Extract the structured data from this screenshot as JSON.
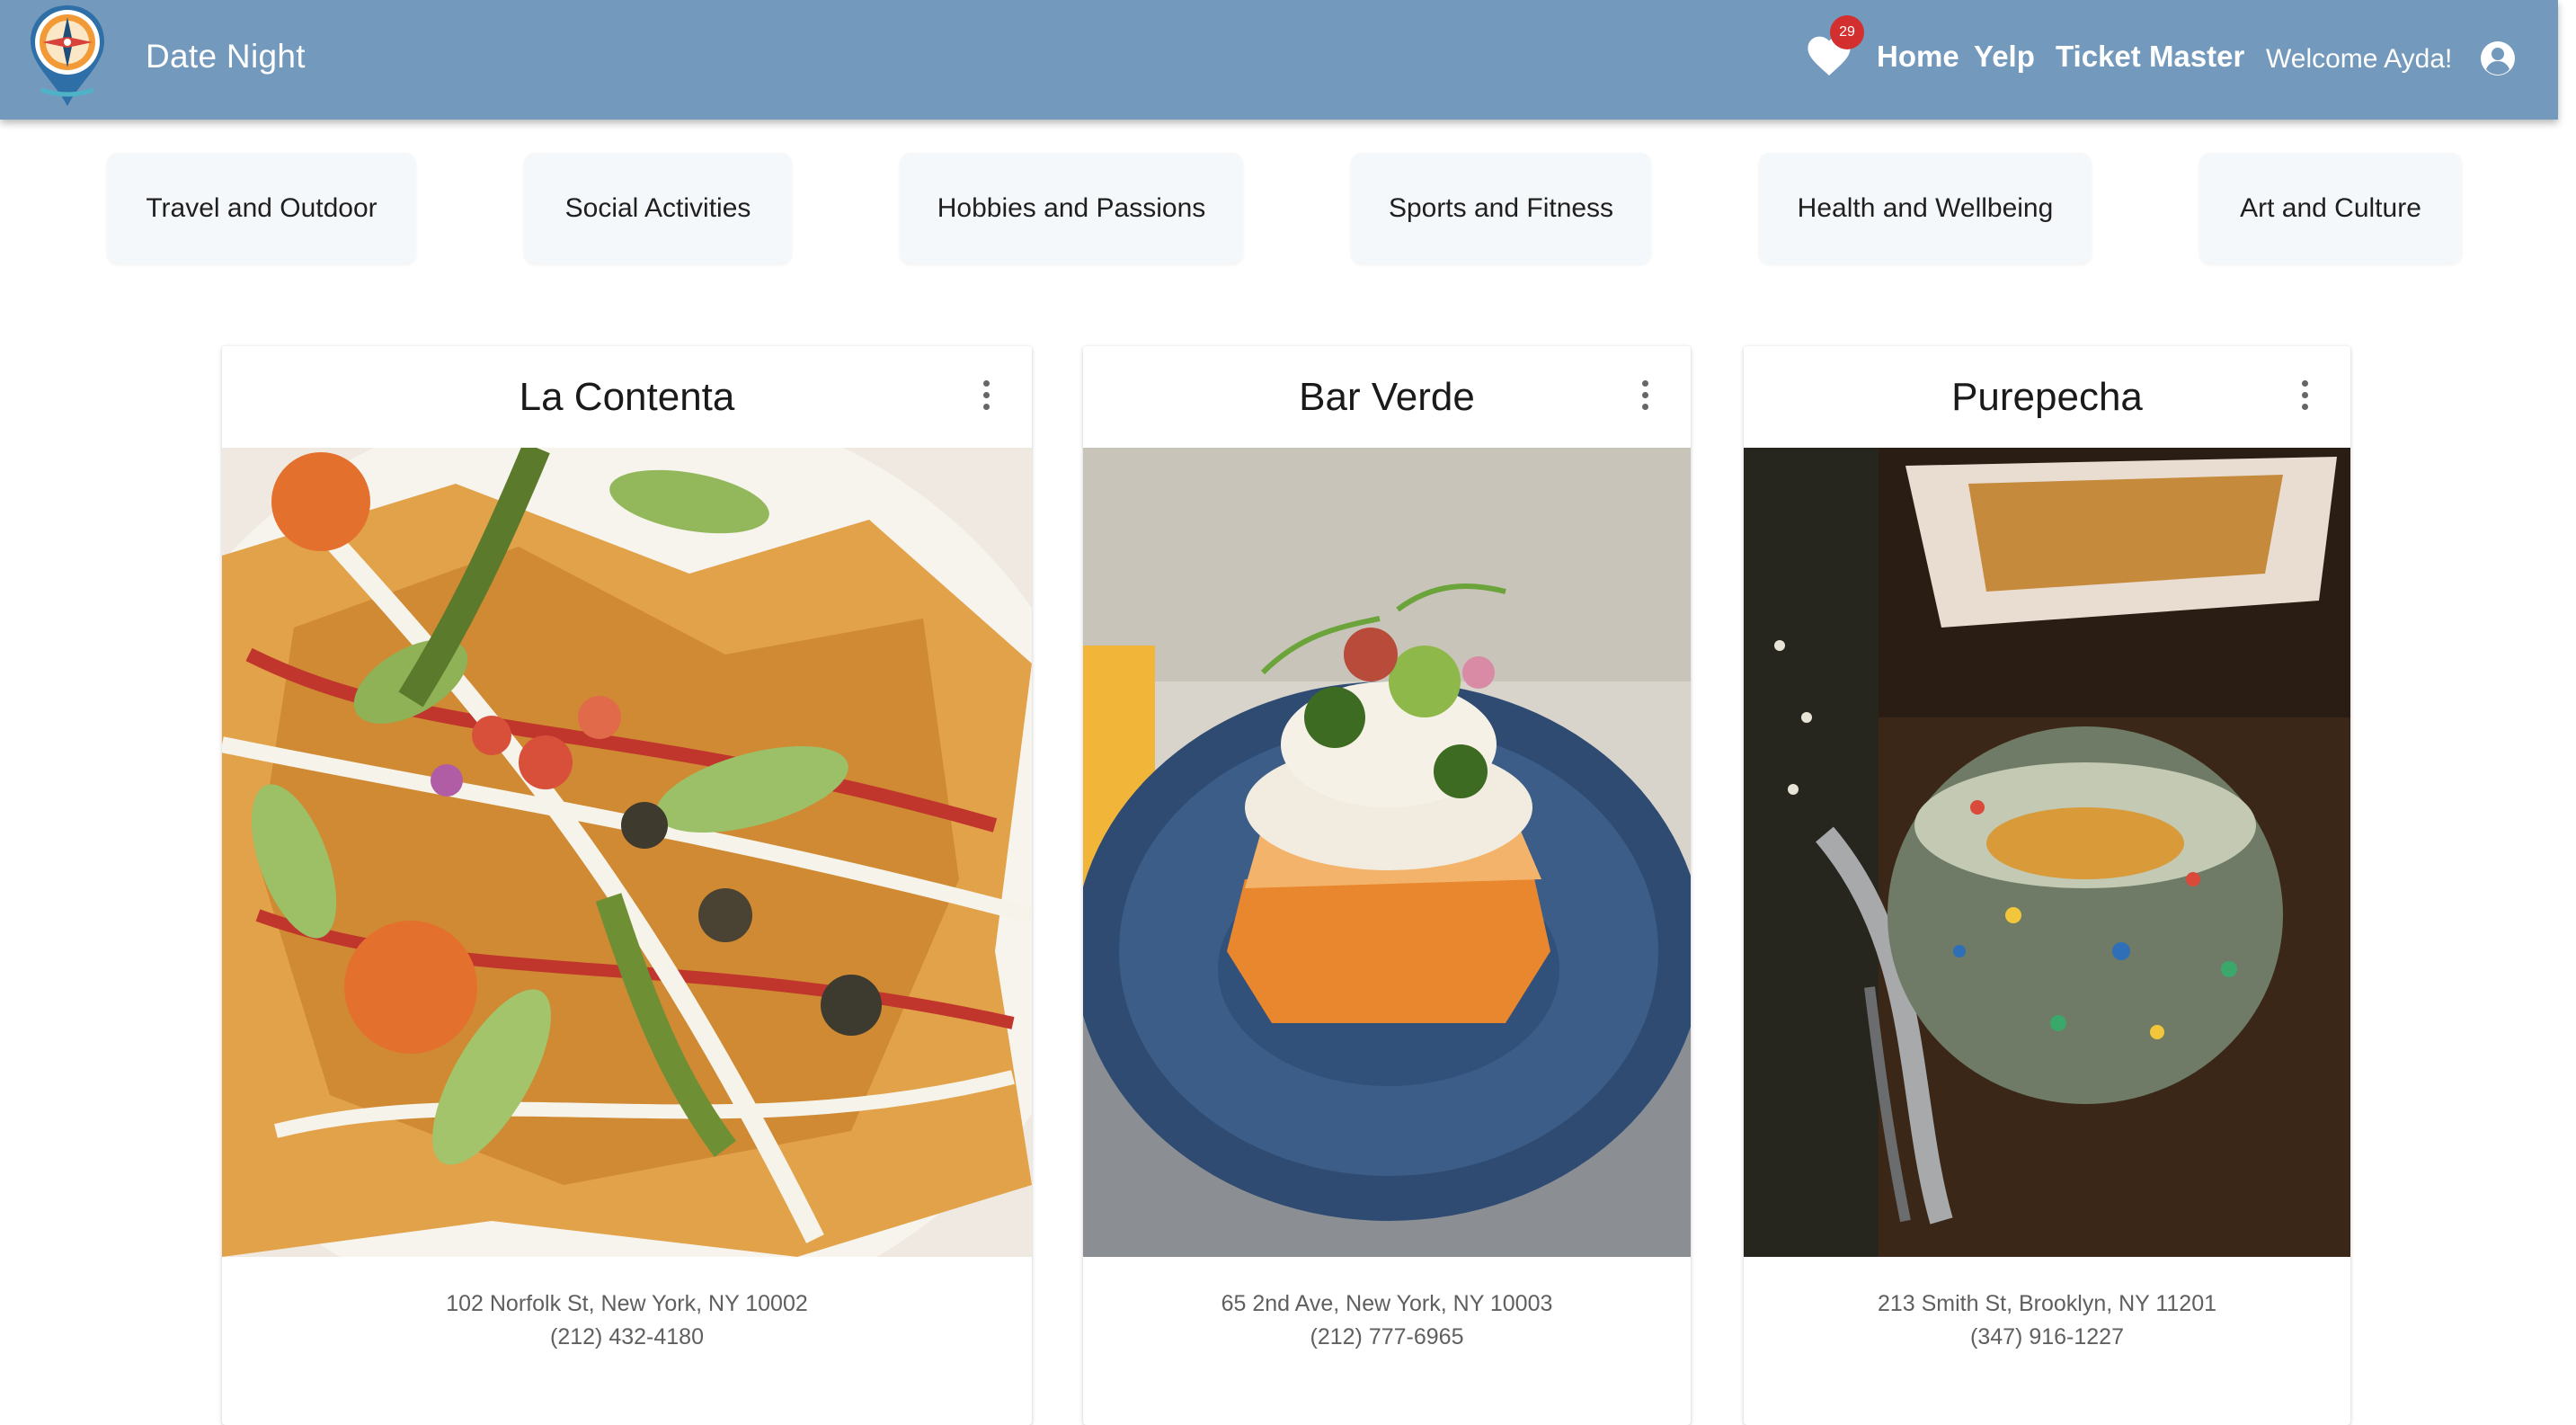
{
  "app": {
    "title": "Date Night",
    "logo_icon": "compass-pin-logo",
    "favorites_count": "29",
    "favorites_icon": "heart-icon",
    "nav": [
      "Home",
      "Yelp",
      "Ticket Master"
    ],
    "welcome": "Welcome Ayda!",
    "account_icon": "account-circle-icon"
  },
  "colors": {
    "appbar": "#7399bd",
    "badge": "#d32f2f",
    "category_bg": "#f5f8fa"
  },
  "categories": [
    "Travel and Outdoor",
    "Social Activities",
    "Hobbies and Passions",
    "Sports and Fitness",
    "Health and Wellbeing",
    "Art and Culture"
  ],
  "cards": [
    {
      "name": "La Contenta",
      "address": "102 Norfolk St, New York, NY 10002",
      "phone": "(212) 432-4180",
      "menu_icon": "more-vert-icon"
    },
    {
      "name": "Bar Verde",
      "address": "65 2nd Ave, New York, NY 10003",
      "phone": "(212) 777-6965",
      "menu_icon": "more-vert-icon"
    },
    {
      "name": "Purepecha",
      "address": "213 Smith St, Brooklyn, NY 11201",
      "phone": "(347) 916-1227",
      "menu_icon": "more-vert-icon"
    }
  ]
}
